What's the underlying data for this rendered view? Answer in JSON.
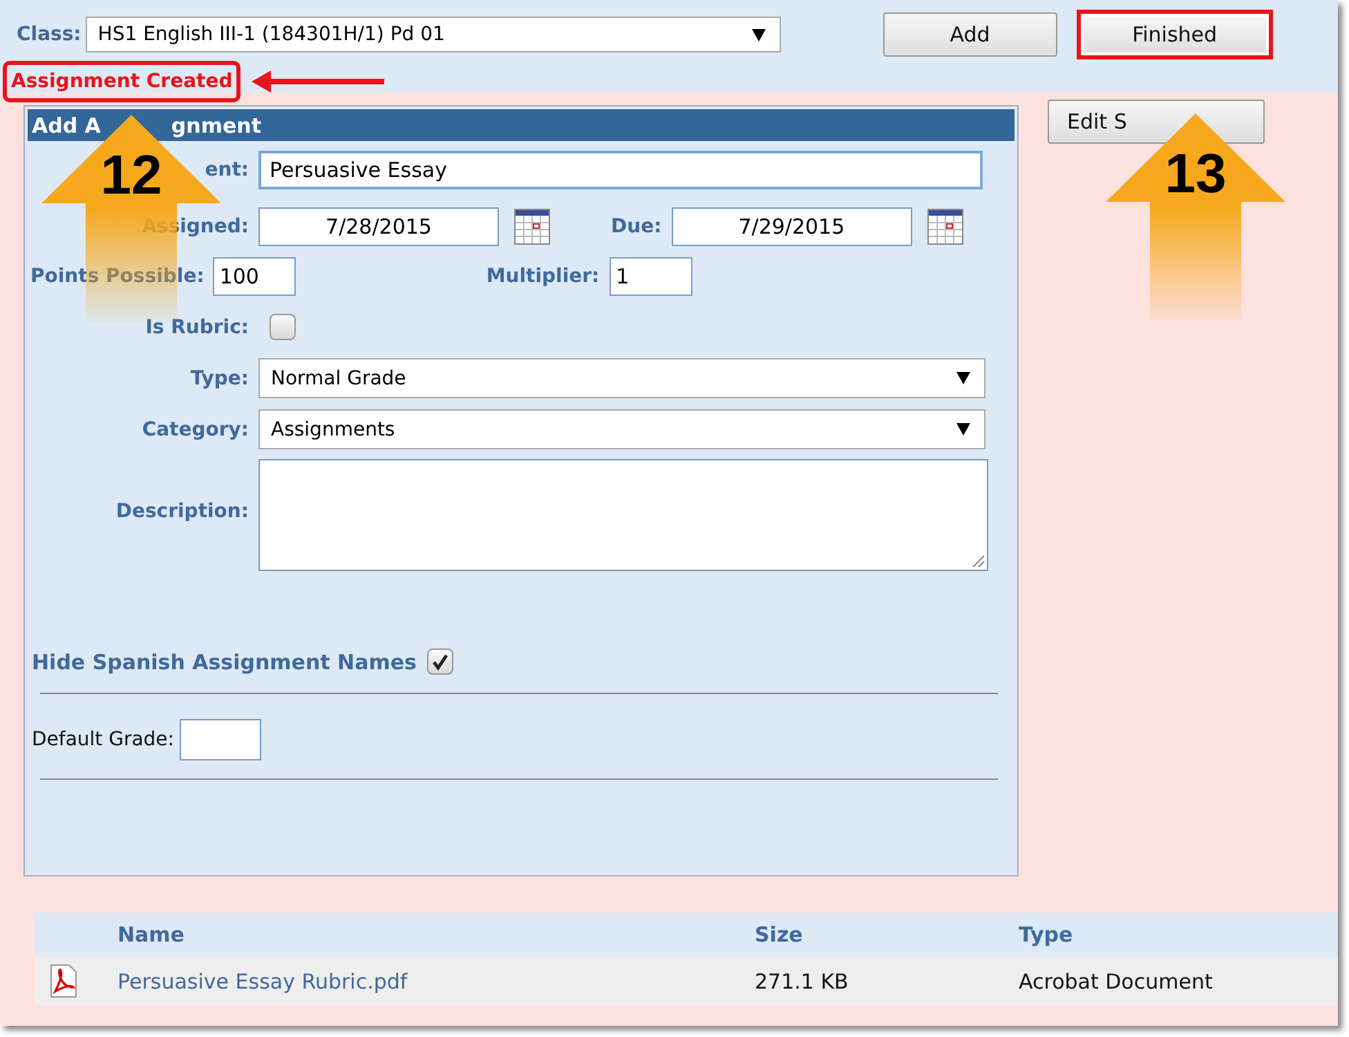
{
  "class_selector": {
    "label": "Class:",
    "value": "HS1 English III-1 (184301H/1) Pd 01"
  },
  "buttons": [
    {
      "label": "Add",
      "highlighted": false
    },
    {
      "label": "Finished",
      "highlighted": true
    }
  ],
  "status_message": {
    "text": "Assignment Created",
    "highlighted": true
  },
  "form": {
    "title_parts": [
      "Add A",
      "gnment"
    ],
    "rows": [
      {
        "kind": "text",
        "label": "ent:",
        "value": "Persuasive Essay"
      },
      {
        "kind": "dates",
        "fields": [
          {
            "label": "Assigned:",
            "value": "7/28/2015"
          },
          {
            "label": "Due:",
            "value": "7/29/2015"
          }
        ]
      },
      {
        "kind": "pair",
        "fields": [
          {
            "label": "Points Possible:",
            "value": "100"
          },
          {
            "label": "Multiplier:",
            "value": "1"
          }
        ]
      },
      {
        "kind": "checkbox",
        "label": "Is Rubric:",
        "checked": false
      },
      {
        "kind": "select",
        "label": "Type:",
        "value": "Normal Grade"
      },
      {
        "kind": "select",
        "label": "Category:",
        "value": "Assignments"
      },
      {
        "kind": "textarea",
        "label": "Description:"
      }
    ],
    "hide_spanish": {
      "label": "Hide Spanish Assignment Names",
      "checked": true
    },
    "default_grade": {
      "label": "Default Grade:"
    }
  },
  "side_button": {
    "label": "Edit S"
  },
  "files": {
    "columns": [
      "Name",
      "Size",
      "Type"
    ],
    "rows": [
      {
        "name": "Persuasive Essay Rubric.pdf",
        "size": "271.1 KB",
        "type": "Acrobat Document"
      }
    ]
  },
  "callouts": [
    {
      "number": "12"
    },
    {
      "number": "13"
    }
  ]
}
